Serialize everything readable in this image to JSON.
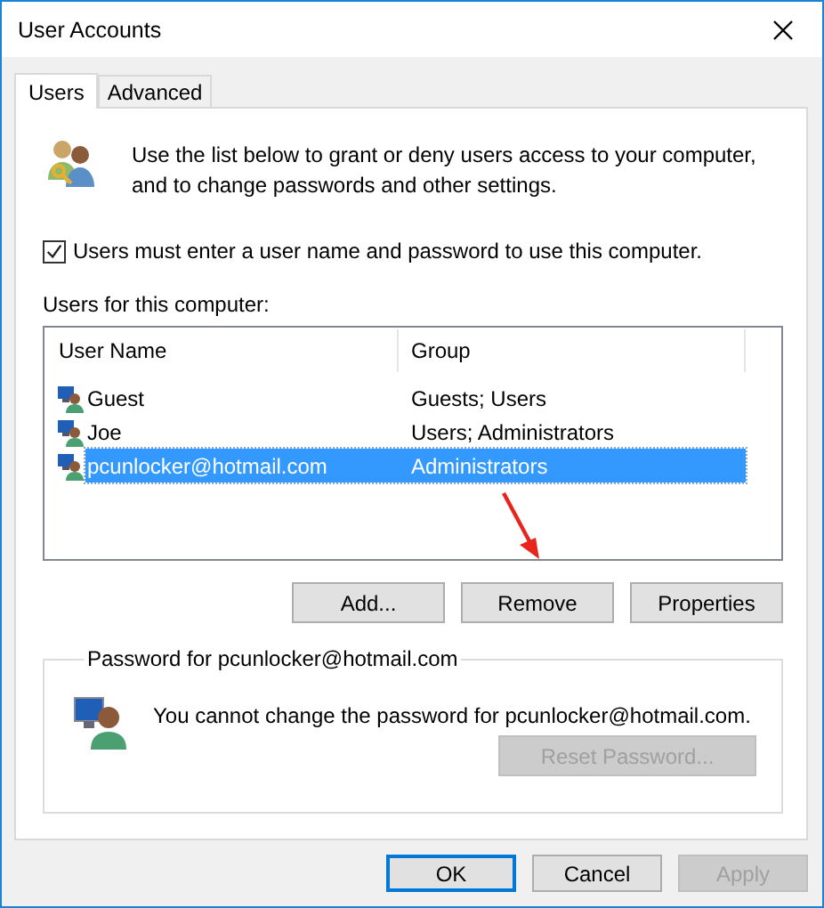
{
  "window": {
    "title": "User Accounts"
  },
  "tabs": [
    {
      "label": "Users",
      "selected": true
    },
    {
      "label": "Advanced",
      "selected": false
    }
  ],
  "intro": "Use the list below to grant or deny users access to your computer,\nand to change passwords and other settings.",
  "require_login": {
    "label": "Users must enter a user name and password to use this computer.",
    "checked": true
  },
  "users_list": {
    "label": "Users for this computer:",
    "columns": [
      "User Name",
      "Group"
    ],
    "rows": [
      {
        "name": "Guest",
        "group": "Guests; Users",
        "selected": false
      },
      {
        "name": "Joe",
        "group": "Users; Administrators",
        "selected": false
      },
      {
        "name": "pcunlocker@hotmail.com",
        "group": "Administrators",
        "selected": true
      }
    ]
  },
  "list_buttons": [
    "Add...",
    "Remove",
    "Properties"
  ],
  "password_group": {
    "title": "Password for pcunlocker@hotmail.com",
    "message": "You cannot change the password for pcunlocker@hotmail.com.",
    "button": {
      "label": "Reset Password...",
      "disabled": true
    }
  },
  "dialog_buttons": [
    {
      "label": "OK",
      "default": true,
      "disabled": false
    },
    {
      "label": "Cancel",
      "default": false,
      "disabled": false
    },
    {
      "label": "Apply",
      "default": false,
      "disabled": true
    }
  ]
}
